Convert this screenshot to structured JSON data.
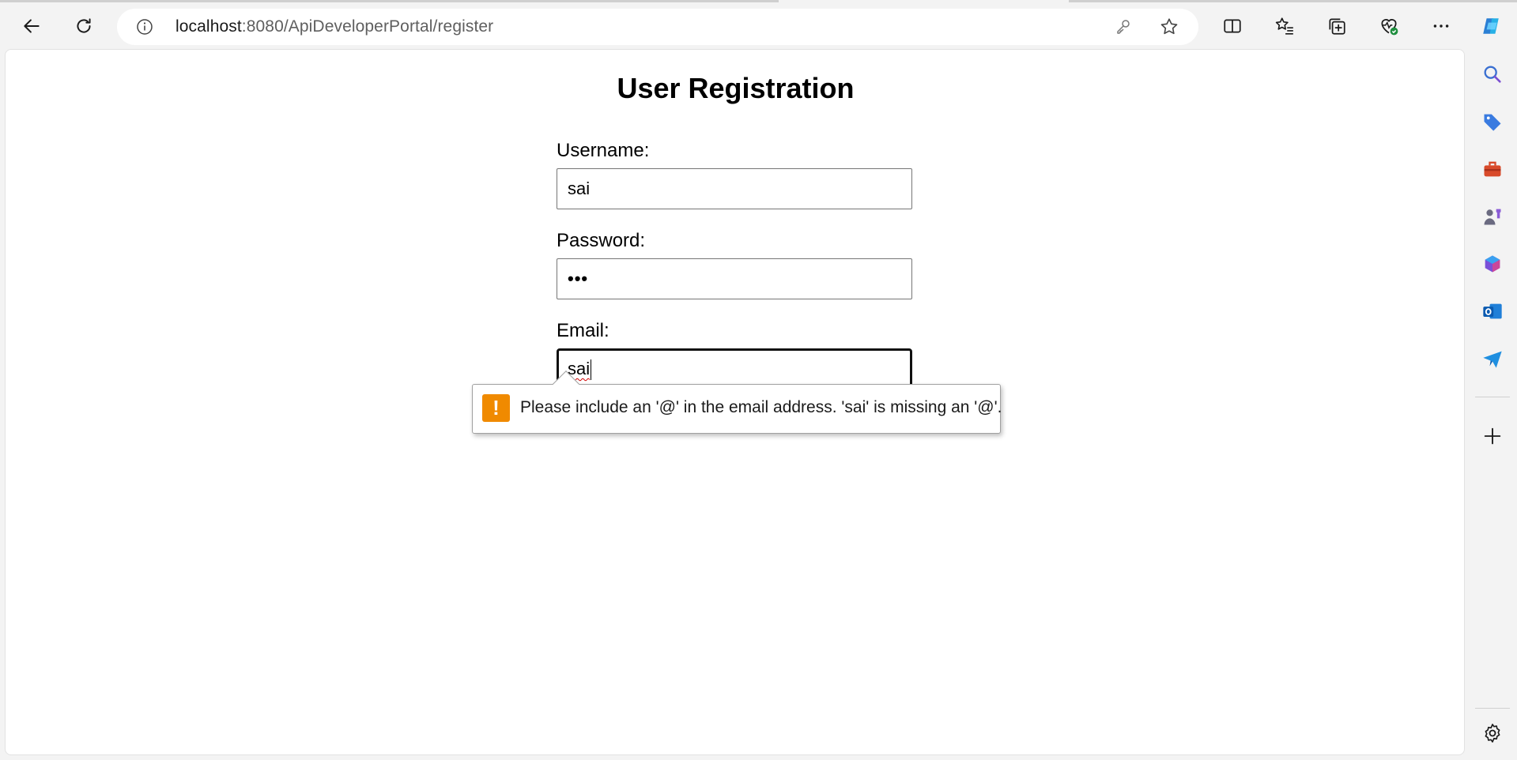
{
  "browser": {
    "url_host": "localhost",
    "url_rest": ":8080/ApiDeveloperPortal/register",
    "toolbar_icons": [
      "back-icon",
      "refresh-icon",
      "info-icon",
      "key-icon",
      "favorite-star-icon",
      "split-screen-icon",
      "favorites-icon",
      "collections-icon",
      "browser-essentials-icon",
      "more-icon",
      "copilot-icon"
    ],
    "sidebar_icons": [
      "search-icon",
      "shopping-tag-icon",
      "tools-icon",
      "games-icon",
      "microsoft365-icon",
      "outlook-icon",
      "send-icon",
      "add-icon",
      "settings-icon"
    ]
  },
  "page": {
    "title": "User Registration",
    "username_label": "Username:",
    "username_value": "sai",
    "password_label": "Password:",
    "password_mask": "•••",
    "email_label": "Email:",
    "email_value": "sai"
  },
  "validation": {
    "message": "Please include an '@' in the email address. 'sai' is missing an '@'.",
    "icon": "!"
  },
  "colors": {
    "warning": "#f08a00",
    "copilot_accent": "#2a7fd4",
    "spellcheck": "#d00000"
  }
}
